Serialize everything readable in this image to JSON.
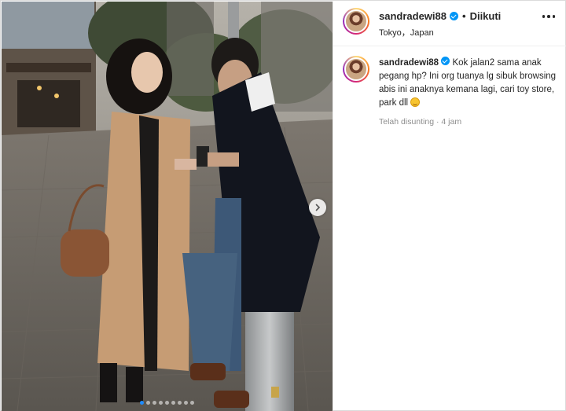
{
  "post": {
    "username": "sandradewi88",
    "separator": "•",
    "follow_status": "Diikuti",
    "location": "Tokyo，Japan"
  },
  "caption": {
    "username": "sandradewi88",
    "text": "Kok jalan2 sama anak pegang hp? Ini org tuanya lg sibuk browsing abis ini anaknya kemana lagi, cari toy store, park dll",
    "emoji": "rolling-on-floor-laughing-emoji",
    "edited_label": "Telah disunting",
    "dot": "·",
    "time": "4 jam"
  },
  "carousel": {
    "total_slides": 9,
    "active_index": 0
  },
  "colors": {
    "verified": "#0095f6",
    "active_dot": "#1f8cff",
    "muted_text": "#8e8e8e"
  }
}
